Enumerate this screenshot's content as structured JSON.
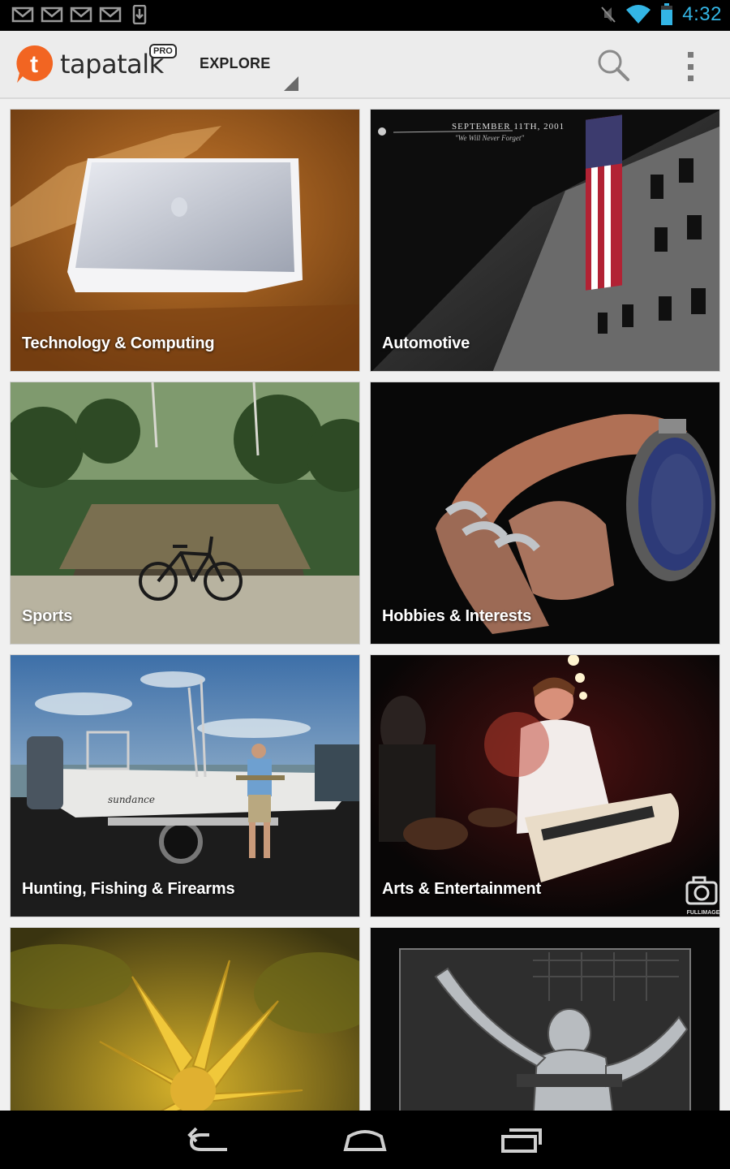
{
  "status_bar": {
    "time": "4:32",
    "notification_icons": [
      "gmail-icon",
      "gmail-icon",
      "gmail-icon",
      "gmail-icon",
      "download-icon"
    ],
    "system_icons": [
      "mute-icon",
      "wifi-icon",
      "battery-icon"
    ],
    "accent_color": "#33b5e5"
  },
  "action_bar": {
    "app_name": "tapatalk",
    "badge": "PRO",
    "brand_color": "#f26522",
    "nav_label": "EXPLORE",
    "actions": [
      "search-icon",
      "overflow-menu-icon"
    ]
  },
  "categories": [
    {
      "label": "Technology & Computing"
    },
    {
      "label": "Automotive",
      "image_caption_line1": "SEPTEMBER 11TH, 2001",
      "image_caption_line2": "\"We Will Never Forget\""
    },
    {
      "label": "Sports"
    },
    {
      "label": "Hobbies & Interests"
    },
    {
      "label": "Hunting, Fishing & Firearms",
      "image_boat_text": "sundance"
    },
    {
      "label": "Arts & Entertainment",
      "image_watermark": "FULLIMAGE"
    },
    {
      "label": ""
    },
    {
      "label": ""
    }
  ],
  "nav_bar": {
    "buttons": [
      "back-icon",
      "home-icon",
      "recent-apps-icon"
    ]
  }
}
